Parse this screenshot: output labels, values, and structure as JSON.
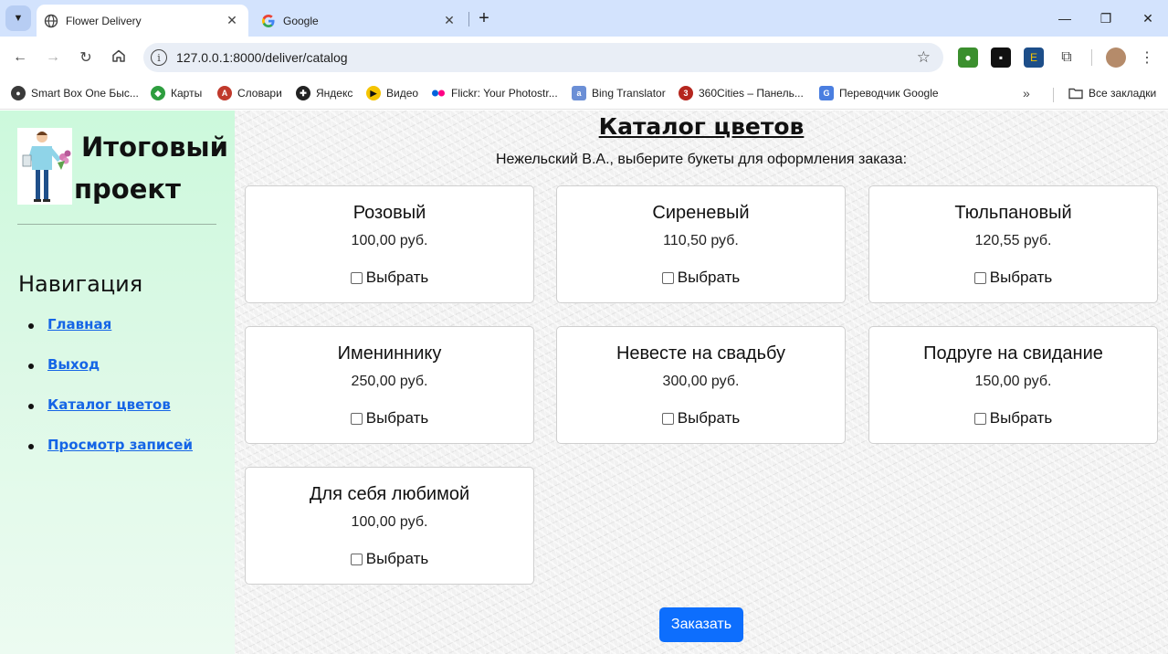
{
  "browser": {
    "tabs": [
      {
        "title": "Flower Delivery",
        "active": true
      },
      {
        "title": "Google",
        "active": false
      }
    ],
    "url": "127.0.0.1:8000/deliver/catalog",
    "bookmarks": [
      {
        "label": "Smart Box One Быс...",
        "icon": "smartbox-icon",
        "color": "#3a3a3a"
      },
      {
        "label": "Карты",
        "icon": "maps-icon",
        "color": "#2e9e3f"
      },
      {
        "label": "Словари",
        "icon": "dictionary-icon",
        "color": "#c0392b"
      },
      {
        "label": "Яндекс",
        "icon": "yandex-icon",
        "color": "#222222"
      },
      {
        "label": "Видео",
        "icon": "video-icon",
        "color": "#f5c400"
      },
      {
        "label": "Flickr: Your Photostr...",
        "icon": "flickr-icon",
        "color": "#ff0084"
      },
      {
        "label": "Bing Translator",
        "icon": "bing-translator-icon",
        "color": "#6b8fd6"
      },
      {
        "label": "360Cities – Панель...",
        "icon": "360cities-icon",
        "color": "#b5261e"
      },
      {
        "label": "Переводчик Google",
        "icon": "google-translate-icon",
        "color": "#4a7ee0"
      }
    ],
    "all_bookmarks": "Все закладки"
  },
  "sidebar": {
    "brand_line1": "Итоговый",
    "brand_line2": "проект",
    "nav_title": "Навигация",
    "nav_items": [
      {
        "label": "Главная"
      },
      {
        "label": "Выход"
      },
      {
        "label": "Каталог цветов"
      },
      {
        "label": "Просмотр записей"
      }
    ]
  },
  "main": {
    "title": "Каталог цветов",
    "subtitle": "Нежельский В.А., выберите букеты для оформления заказа:",
    "select_label": "Выбрать",
    "order_button": "Заказать",
    "bouquets": [
      {
        "name": "Розовый",
        "price": "100,00 руб."
      },
      {
        "name": "Сиреневый",
        "price": "110,50 руб."
      },
      {
        "name": "Тюльпановый",
        "price": "120,55 руб."
      },
      {
        "name": "Имениннику",
        "price": "250,00 руб."
      },
      {
        "name": "Невесте на свадьбу",
        "price": "300,00 руб."
      },
      {
        "name": "Подруге на свидание",
        "price": "150,00 руб."
      },
      {
        "name": "Для себя любимой",
        "price": "100,00 руб."
      }
    ]
  },
  "colors": {
    "accent": "#0d6efd",
    "link": "#1565e6",
    "sidebar_bg": "#ccf9dc"
  }
}
